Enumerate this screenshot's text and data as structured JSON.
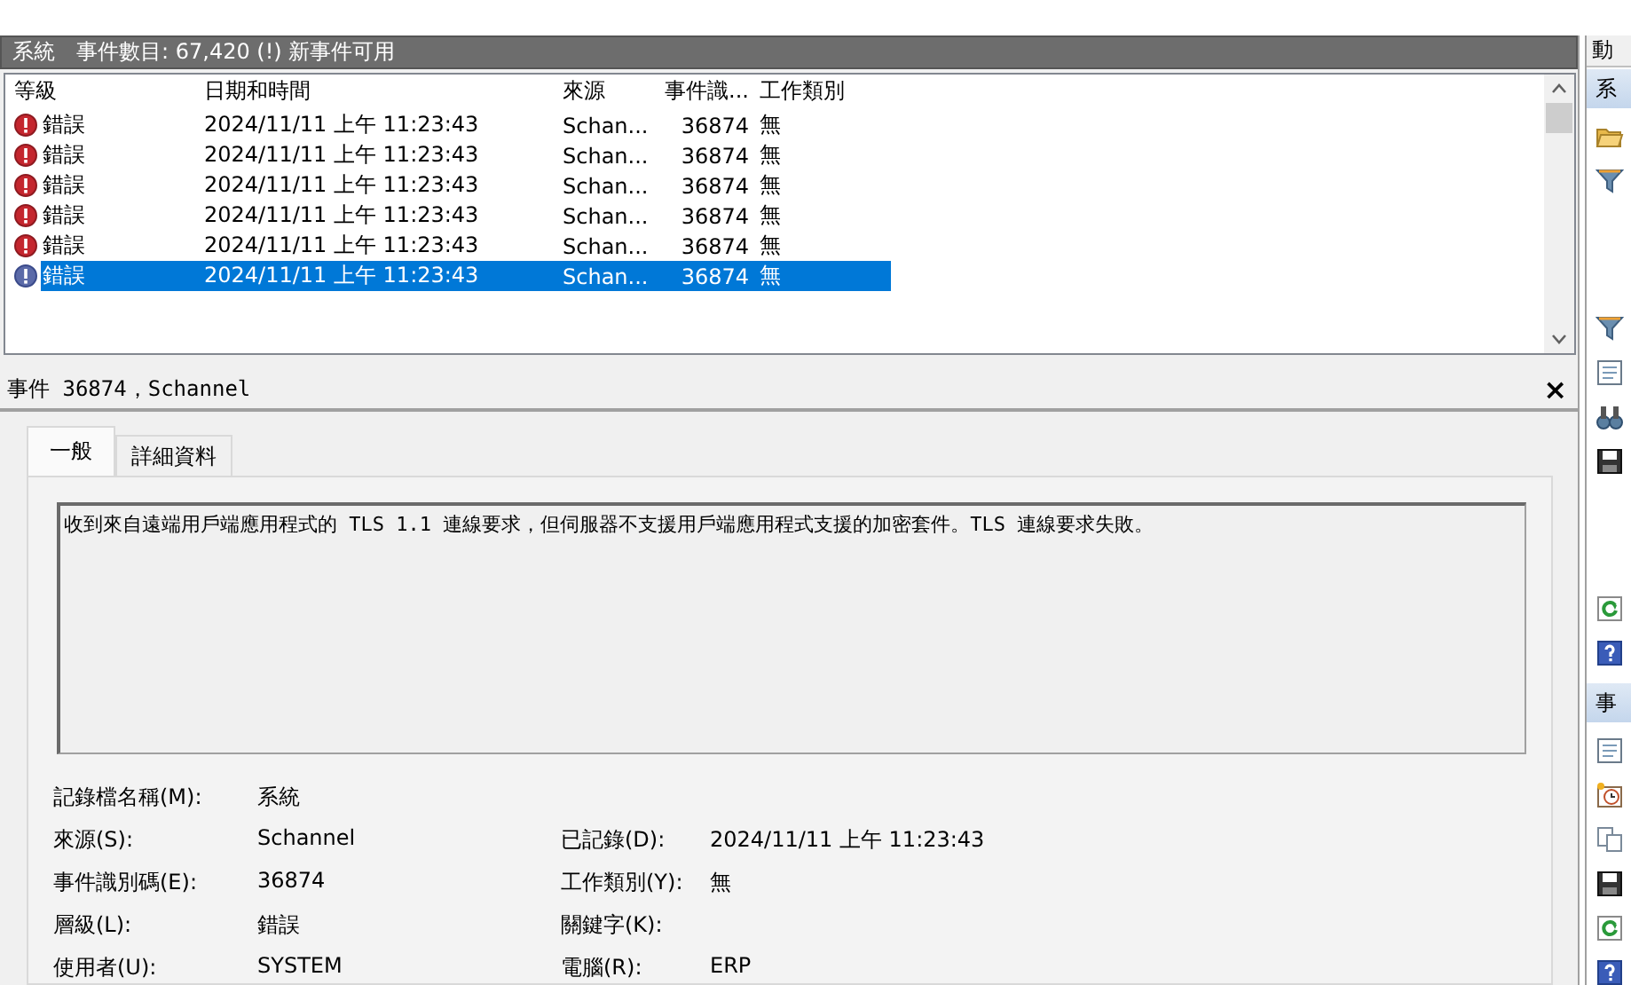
{
  "log_header": {
    "name": "系統",
    "summary": "事件數目: 67,420 (!) 新事件可用"
  },
  "events": {
    "columns": [
      "等級",
      "日期和時間",
      "來源",
      "事件識...",
      "工作類別"
    ],
    "rows": [
      {
        "level": "錯誤",
        "date": "2024/11/11 上午 11:23:43",
        "source": "Schan...",
        "event_id": "36874",
        "task": "無",
        "selected": false
      },
      {
        "level": "錯誤",
        "date": "2024/11/11 上午 11:23:43",
        "source": "Schan...",
        "event_id": "36874",
        "task": "無",
        "selected": false
      },
      {
        "level": "錯誤",
        "date": "2024/11/11 上午 11:23:43",
        "source": "Schan...",
        "event_id": "36874",
        "task": "無",
        "selected": false
      },
      {
        "level": "錯誤",
        "date": "2024/11/11 上午 11:23:43",
        "source": "Schan...",
        "event_id": "36874",
        "task": "無",
        "selected": false
      },
      {
        "level": "錯誤",
        "date": "2024/11/11 上午 11:23:43",
        "source": "Schan...",
        "event_id": "36874",
        "task": "無",
        "selected": false
      },
      {
        "level": "錯誤",
        "date": "2024/11/11 上午 11:23:43",
        "source": "Schan...",
        "event_id": "36874",
        "task": "無",
        "selected": true
      }
    ]
  },
  "detail": {
    "title": "事件 36874，Schannel",
    "close": "×",
    "tabs": [
      {
        "label": "一般",
        "selected": true
      },
      {
        "label": "詳細資料",
        "selected": false
      }
    ],
    "message": "收到來自遠端用戶端應用程式的 TLS 1.1 連線要求，但伺服器不支援用戶端應用程式支援的加密套件。TLS 連線要求失敗。",
    "properties": [
      {
        "label": "記錄檔名稱(M):",
        "value": "系統"
      },
      {
        "label": "來源(S):",
        "value": "Schannel",
        "label_2": "已記錄(D):",
        "value_2": "2024/11/11 上午 11:23:43"
      },
      {
        "label": "事件識別碼(E):",
        "value": "36874",
        "label_2": "工作類別(Y):",
        "value_2": "無"
      },
      {
        "label": "層級(L):",
        "value": "錯誤",
        "label_2": "關鍵字(K):"
      },
      {
        "label": "使用者(U):",
        "value": "SYSTEM",
        "label_2": "電腦(R):",
        "value_2": "ERP"
      }
    ]
  },
  "actions": {
    "title": "動",
    "sections": [
      {
        "title": "系",
        "groups": [
          [
            {
              "kind": "folder"
            },
            {
              "kind": "filter"
            }
          ],
          [
            {
              "kind": "filter"
            },
            {
              "kind": "properties"
            },
            {
              "kind": "binoculars"
            },
            {
              "kind": "save"
            }
          ],
          [
            {
              "kind": "refresh"
            },
            {
              "kind": "help"
            }
          ]
        ]
      },
      {
        "title": "事",
        "groups": [
          [
            {
              "kind": "properties"
            },
            {
              "kind": "clock"
            },
            {
              "kind": "copy"
            },
            {
              "kind": "save"
            },
            {
              "kind": "refresh"
            },
            {
              "kind": "help"
            }
          ]
        ]
      }
    ]
  }
}
